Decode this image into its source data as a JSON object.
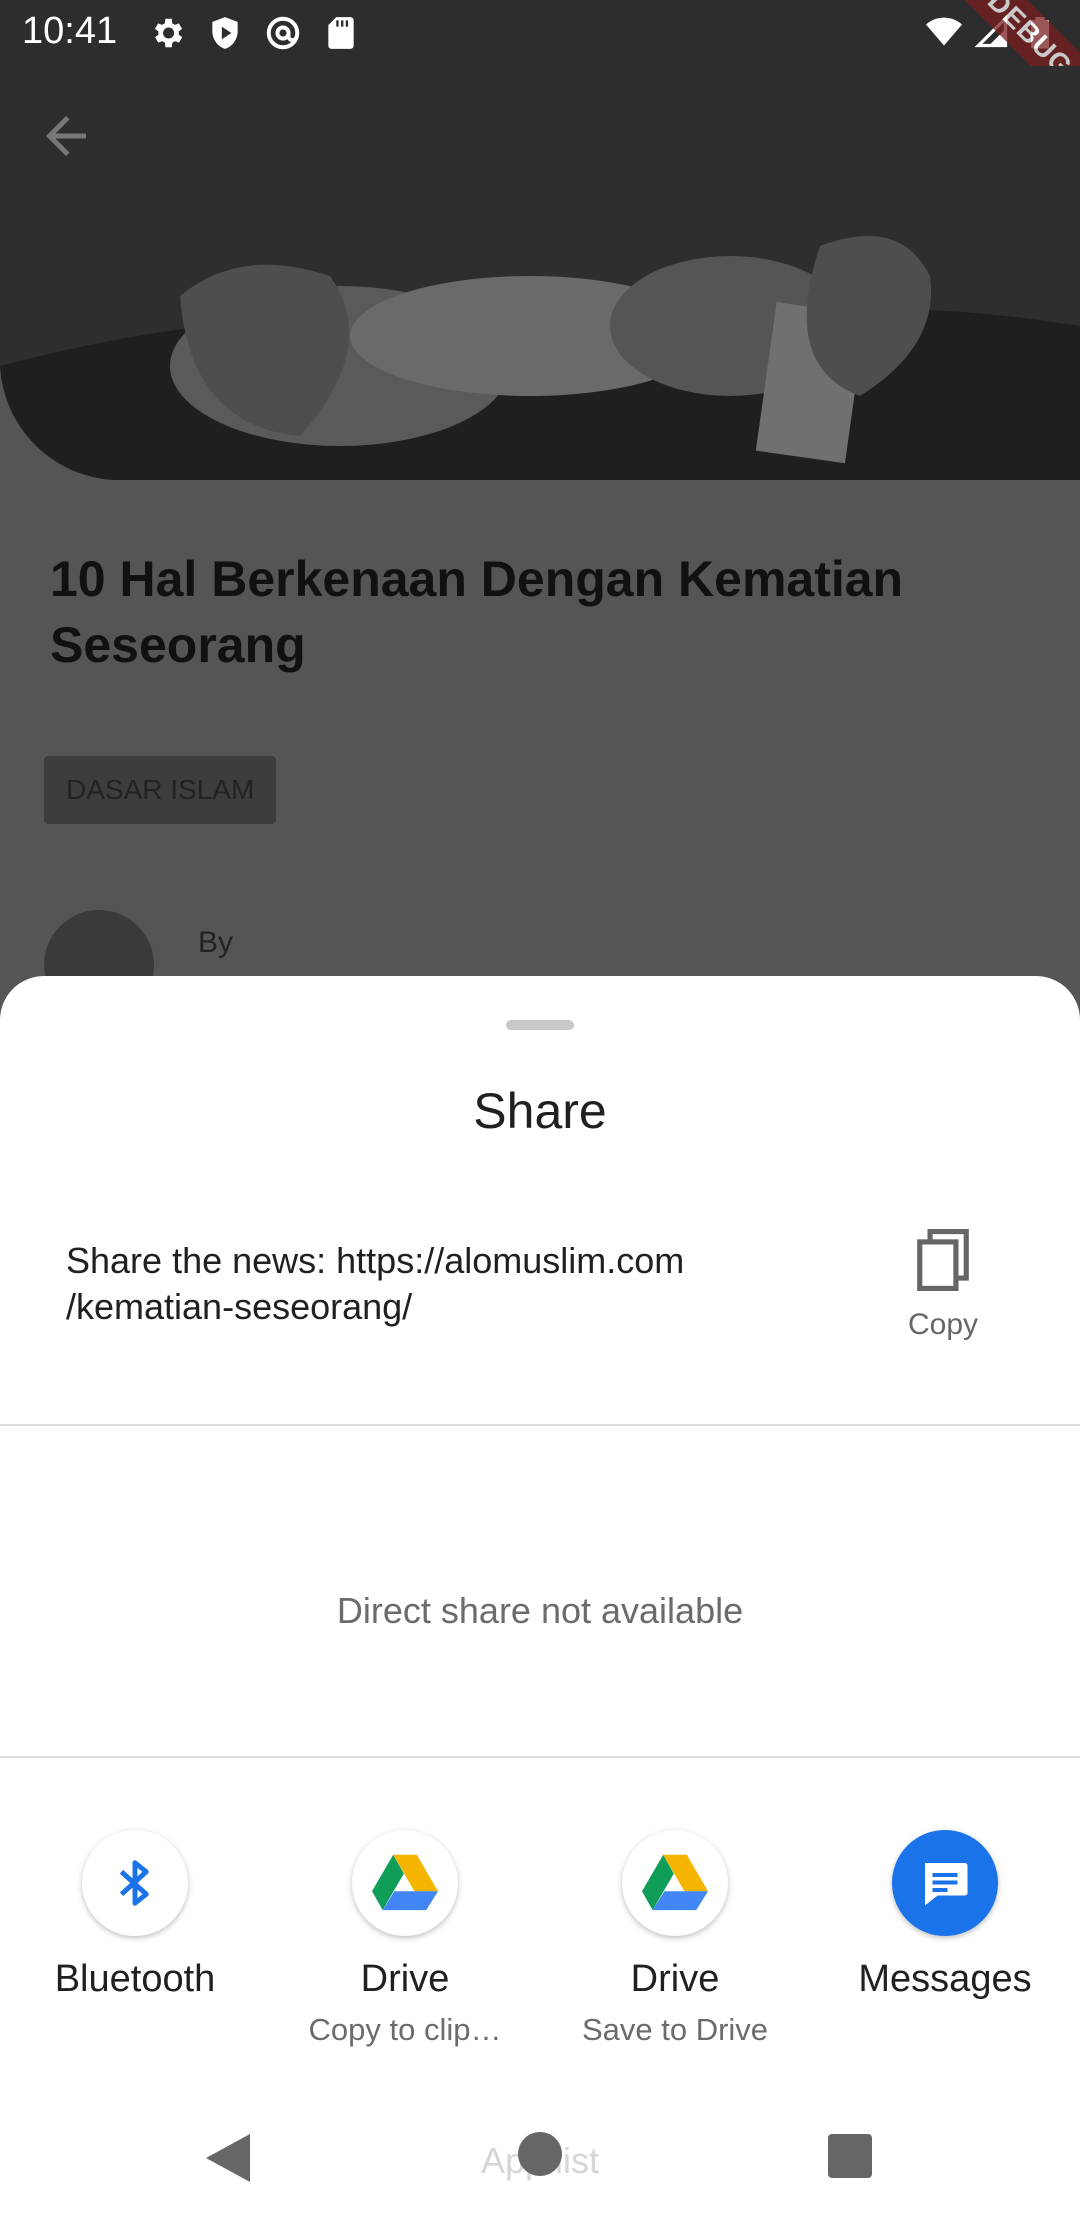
{
  "status": {
    "time": "10:41",
    "left_icons": [
      "settings-icon",
      "shield-icon",
      "at-sign-icon",
      "sd-card-icon"
    ],
    "right_icons": [
      "wifi-icon",
      "signal-icon",
      "battery-icon"
    ],
    "debug_banner": "DEBUG"
  },
  "article": {
    "title": "10 Hal Berkenaan Dengan Kematian Seseorang",
    "category": "DASAR ISLAM",
    "author_prefix": "By"
  },
  "sheet": {
    "title": "Share",
    "share_text": "Share the news: https://alomuslim.com /kematian-seseorang/",
    "copy_label": "Copy",
    "direct_share_text": "Direct share not available",
    "apps": [
      {
        "name": "Bluetooth",
        "sub": "",
        "icon": "bluetooth-icon"
      },
      {
        "name": "Drive",
        "sub": "Copy to clip…",
        "icon": "google-drive-icon"
      },
      {
        "name": "Drive",
        "sub": "Save to Drive",
        "icon": "google-drive-icon"
      },
      {
        "name": "Messages",
        "sub": "",
        "icon": "messages-icon"
      }
    ]
  },
  "navbar": {
    "overlay_text": "App list"
  },
  "colors": {
    "bluetooth": "#1a73e8",
    "messages": "#1a73e8",
    "drive_green": "#0f9d58",
    "drive_yellow": "#f4b400",
    "drive_blue": "#4285f4"
  }
}
